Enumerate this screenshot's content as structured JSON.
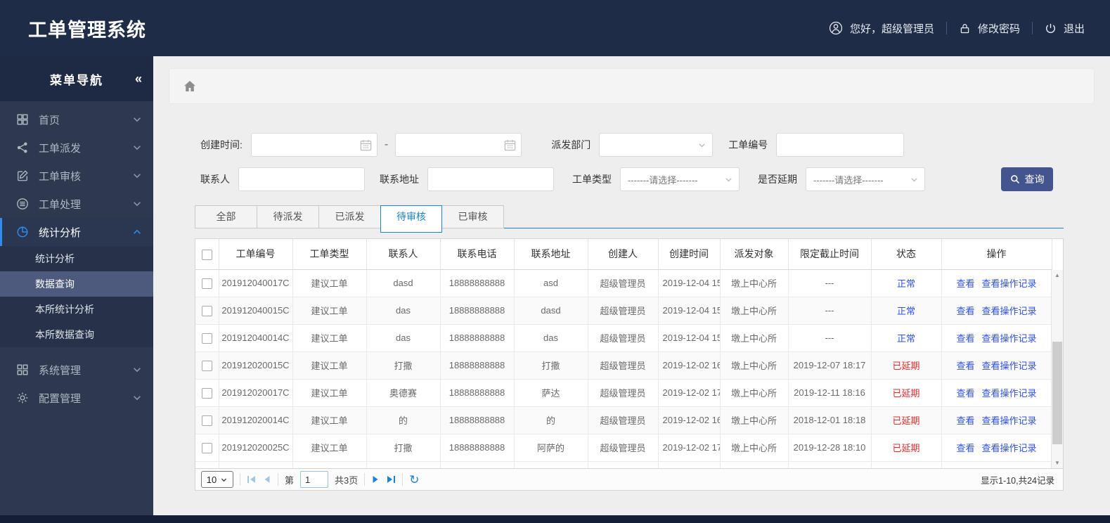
{
  "header": {
    "title": "工单管理系统",
    "greeting": "您好，超级管理员",
    "change_password": "修改密码",
    "logout": "退出"
  },
  "sidebar": {
    "title": "菜单导航",
    "collapse_icon": "«",
    "items": [
      {
        "id": "home",
        "label": "首页",
        "icon": "grid-icon",
        "expanded": false,
        "active": false
      },
      {
        "id": "dispatch",
        "label": "工单派发",
        "icon": "share-icon",
        "expanded": false,
        "active": false
      },
      {
        "id": "review",
        "label": "工单审核",
        "icon": "edit-icon",
        "expanded": false,
        "active": false
      },
      {
        "id": "process",
        "label": "工单处理",
        "icon": "database-icon",
        "expanded": false,
        "active": false
      },
      {
        "id": "stats",
        "label": "统计分析",
        "icon": "pie-chart-icon",
        "expanded": true,
        "active": true,
        "children": [
          {
            "label": "统计分析",
            "active": false
          },
          {
            "label": "数据查询",
            "active": true
          },
          {
            "label": "本所统计分析",
            "active": false
          },
          {
            "label": "本所数据查询",
            "active": false
          }
        ]
      },
      {
        "id": "system",
        "label": "系统管理",
        "icon": "squares-icon",
        "expanded": false,
        "active": false,
        "gap": true
      },
      {
        "id": "config",
        "label": "配置管理",
        "icon": "gear-icon",
        "expanded": false,
        "active": false
      }
    ]
  },
  "filters": {
    "create_time_label": "创建时间:",
    "date_separator": "-",
    "dispatch_dept_label": "派发部门",
    "order_no_label": "工单编号",
    "contact_label": "联系人",
    "address_label": "联系地址",
    "order_type_label": "工单类型",
    "delay_label": "是否延期",
    "select_placeholder": "-------请选择-------",
    "search_button": "查询"
  },
  "tabs": [
    {
      "label": "全部",
      "active": false
    },
    {
      "label": "待派发",
      "active": false
    },
    {
      "label": "已派发",
      "active": false
    },
    {
      "label": "待审核",
      "active": true
    },
    {
      "label": "已审核",
      "active": false
    }
  ],
  "table": {
    "columns": [
      "工单编号",
      "工单类型",
      "联系人",
      "联系电话",
      "联系地址",
      "创建人",
      "创建时间",
      "派发对象",
      "限定截止时间",
      "状态",
      "操作"
    ],
    "action_labels": [
      "查看",
      "查看操作记录"
    ],
    "rows": [
      {
        "order_no": "201912040017C",
        "type": "建议工单",
        "contact": "dasd",
        "phone": "18888888888",
        "address": "asd",
        "creator": "超级管理员",
        "created": "2019-12-04 15",
        "target": "墩上中心所",
        "deadline": "---",
        "status": "正常",
        "delayed": false
      },
      {
        "order_no": "201912040015C",
        "type": "建议工单",
        "contact": "das",
        "phone": "18888888888",
        "address": "dasd",
        "creator": "超级管理员",
        "created": "2019-12-04 15",
        "target": "墩上中心所",
        "deadline": "---",
        "status": "正常",
        "delayed": false
      },
      {
        "order_no": "201912040014C",
        "type": "建议工单",
        "contact": "das",
        "phone": "18888888888",
        "address": "das",
        "creator": "超级管理员",
        "created": "2019-12-04 15",
        "target": "墩上中心所",
        "deadline": "---",
        "status": "正常",
        "delayed": false
      },
      {
        "order_no": "201912020015C",
        "type": "建议工单",
        "contact": "打撒",
        "phone": "18888888888",
        "address": "打撒",
        "creator": "超级管理员",
        "created": "2019-12-02 16",
        "target": "墩上中心所",
        "deadline": "2019-12-07 18:17",
        "status": "已延期",
        "delayed": true
      },
      {
        "order_no": "201912020017C",
        "type": "建议工单",
        "contact": "奥德赛",
        "phone": "18888888888",
        "address": "萨达",
        "creator": "超级管理员",
        "created": "2019-12-02 17",
        "target": "墩上中心所",
        "deadline": "2019-12-11 18:16",
        "status": "已延期",
        "delayed": true
      },
      {
        "order_no": "201912020014C",
        "type": "建议工单",
        "contact": "的",
        "phone": "18888888888",
        "address": "的",
        "creator": "超级管理员",
        "created": "2019-12-02 16",
        "target": "墩上中心所",
        "deadline": "2018-12-01 18:18",
        "status": "已延期",
        "delayed": true
      },
      {
        "order_no": "201912020025C",
        "type": "建议工单",
        "contact": "打撒",
        "phone": "18888888888",
        "address": "阿萨的",
        "creator": "超级管理员",
        "created": "2019-12-02 17",
        "target": "墩上中心所",
        "deadline": "2019-12-28 18:10",
        "status": "已延期",
        "delayed": true
      }
    ]
  },
  "pagination": {
    "page_size": "10",
    "page_prefix": "第",
    "page": "1",
    "total_pages": "共3页",
    "info": "显示1-10,共24记录"
  },
  "colors": {
    "header_bg": "#1f2c47",
    "sidebar_bg": "#2e3950",
    "sidebar_active_item": "#4d5a7d",
    "accent_blue": "#2d8cf0",
    "tab_active": "#1c84c6",
    "button_bg": "#44548f",
    "status_normal": "#2d50e8",
    "status_delayed": "#e02b2b",
    "link": "#2d50e8",
    "footer_strip": "#141f37"
  }
}
